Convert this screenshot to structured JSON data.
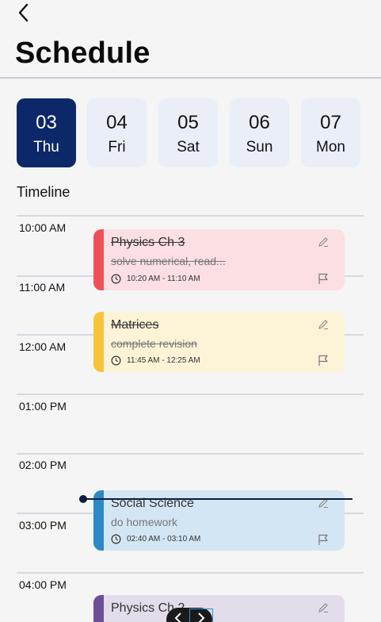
{
  "header": {
    "back_icon": "chevron-left-icon",
    "title": "Schedule"
  },
  "days": [
    {
      "num": "03",
      "weekday": "Thu",
      "active": true
    },
    {
      "num": "04",
      "weekday": "Fri",
      "active": false
    },
    {
      "num": "05",
      "weekday": "Sat",
      "active": false
    },
    {
      "num": "06",
      "weekday": "Sun",
      "active": false
    },
    {
      "num": "07",
      "weekday": "Mon",
      "active": false
    }
  ],
  "timeline": {
    "label": "Timeline",
    "hours": [
      "10:00 AM",
      "11:00 AM",
      "12:00 AM",
      "01:00 PM",
      "02:00 PM",
      "03:00 PM",
      "04:00 PM"
    ]
  },
  "events": [
    {
      "title": "Physics Ch 3",
      "desc": "solve numerical, read...",
      "time": "10:20 AM - 11:10 AM",
      "bar_color": "#f0505a",
      "bg_color": "#fbdfe2",
      "completed": true
    },
    {
      "title": "Matrices",
      "desc": "complete revision",
      "time": "11:45 AM - 12:25 AM",
      "bar_color": "#f7c43c",
      "bg_color": "#fdf3d6",
      "completed": true
    },
    {
      "title": "Social Science",
      "desc": "do homework",
      "time": "02:40 AM - 03:10 AM",
      "bar_color": "#2b8ac6",
      "bg_color": "#d3e6f3",
      "completed": false
    },
    {
      "title": "Physics Ch 2",
      "desc": "",
      "time": "",
      "bar_color": "#6c4f96",
      "bg_color": "#e3dcea",
      "completed": false
    }
  ],
  "colors": {
    "accent": "#0d2868",
    "now_indicator": "#0b1b45"
  }
}
